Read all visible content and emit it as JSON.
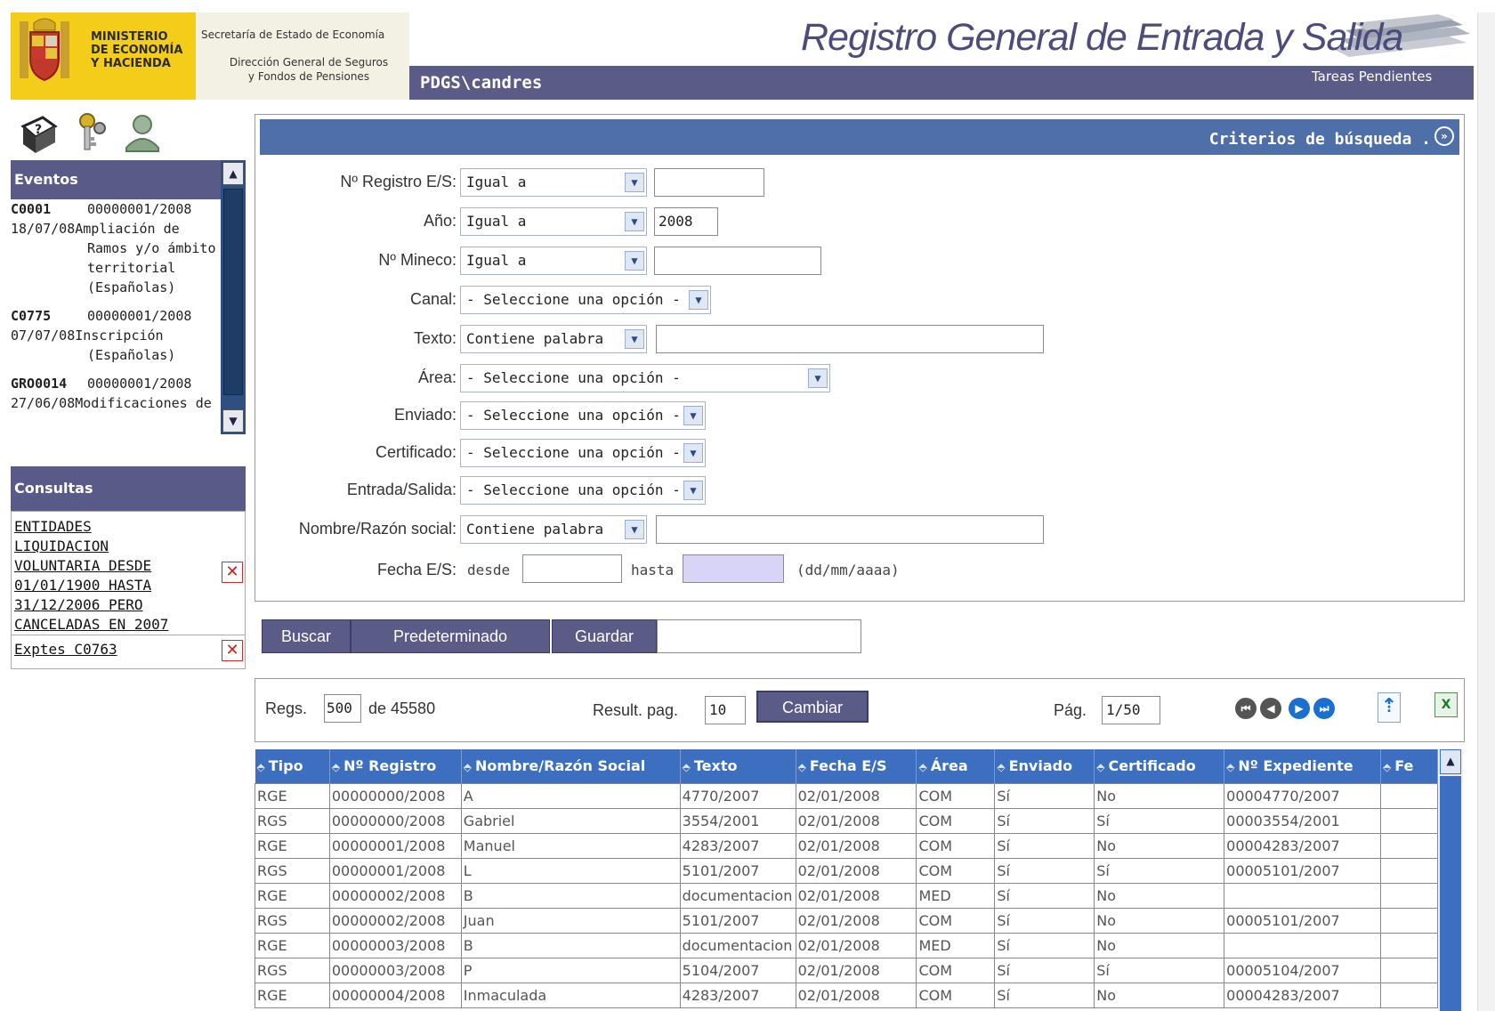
{
  "header": {
    "ministry": [
      "MINISTERIO",
      "DE ECONOMÍA",
      "Y HACIENDA"
    ],
    "secretary": "Secretaría de Estado de Economía",
    "directorate": [
      "Dirección General de Seguros",
      "y Fondos de Pensiones"
    ],
    "app_title": "Registro General de Entrada y Salida",
    "user": "PDGS\\candres",
    "tasks_link": "Tareas Pendientes"
  },
  "toolbar_icons": [
    "help-book-icon",
    "keys-icon",
    "user-icon"
  ],
  "events": {
    "title": "Eventos",
    "items": [
      {
        "code": "C0001",
        "number": "00000001/2008",
        "date": "18/07/08",
        "text": [
          "Ampliación de",
          "Ramos y/o ámbito",
          "territorial",
          "(Españolas)"
        ]
      },
      {
        "code": "C0775",
        "number": "00000001/2008",
        "date": "07/07/08",
        "text": [
          "Inscripción",
          "(Españolas)"
        ]
      },
      {
        "code": "GRO0014",
        "number": "00000001/2008",
        "date": "27/06/08",
        "text": [
          "Modificaciones de"
        ]
      }
    ]
  },
  "queries": {
    "title": "Consultas",
    "items": [
      {
        "lines": [
          "ENTIDADES",
          "LIQUIDACION",
          "VOLUNTARIA DESDE",
          "01/01/1900 HASTA",
          "31/12/2006 PERO",
          "CANCELADAS EN 2007"
        ]
      },
      {
        "lines": [
          "Exptes C0763"
        ]
      }
    ]
  },
  "search": {
    "title": "Criterios de búsqueda .",
    "fields": {
      "registro": {
        "label": "Nº Registro E/S:",
        "op": "Igual a",
        "value": ""
      },
      "anio": {
        "label": "Año:",
        "op": "Igual a",
        "value": "2008"
      },
      "mineco": {
        "label": "Nº Mineco:",
        "op": "Igual a",
        "value": ""
      },
      "canal": {
        "label": "Canal:",
        "op": "- Seleccione una opción -"
      },
      "texto": {
        "label": "Texto:",
        "op": "Contiene palabra",
        "value": ""
      },
      "area": {
        "label": "Área:",
        "op": "- Seleccione una opción -"
      },
      "enviado": {
        "label": "Enviado:",
        "op": "- Seleccione una opción -"
      },
      "certificado": {
        "label": "Certificado:",
        "op": "- Seleccione una opción -"
      },
      "entrada_salida": {
        "label": "Entrada/Salida:",
        "op": "- Seleccione una opción -"
      },
      "nombre": {
        "label": "Nombre/Razón social:",
        "op": "Contiene palabra",
        "value": ""
      },
      "fecha": {
        "label": "Fecha E/S:",
        "desde": "desde",
        "hasta": "hasta",
        "format": "(dd/mm/aaaa)"
      }
    }
  },
  "buttons": {
    "buscar": "Buscar",
    "predeterminado": "Predeterminado",
    "guardar": "Guardar",
    "cambiar": "Cambiar"
  },
  "results": {
    "regs_label": "Regs.",
    "regs_value": "500",
    "total": "de 45580",
    "per_page_label": "Result. pag.",
    "per_page_value": "10",
    "page_label": "Pág.",
    "page_value": "1/50"
  },
  "table": {
    "columns": [
      "Tipo",
      "Nº Registro",
      "Nombre/Razón Social",
      "Texto",
      "Fecha E/S",
      "Área",
      "Enviado",
      "Certificado",
      "Nº Expediente",
      "Fe"
    ],
    "rows": [
      [
        "RGE",
        "00000000/2008",
        "A",
        "4770/2007",
        "02/01/2008",
        "COM",
        "Sí",
        "No",
        "00004770/2007",
        ""
      ],
      [
        "RGS",
        "00000000/2008",
        "Gabriel",
        "3554/2001",
        "02/01/2008",
        "COM",
        "Sí",
        "Sí",
        "00003554/2001",
        ""
      ],
      [
        "RGE",
        "00000001/2008",
        "Manuel",
        "4283/2007",
        "02/01/2008",
        "COM",
        "Sí",
        "No",
        "00004283/2007",
        ""
      ],
      [
        "RGS",
        "00000001/2008",
        "L",
        "5101/2007",
        "02/01/2008",
        "COM",
        "Sí",
        "Sí",
        "00005101/2007",
        ""
      ],
      [
        "RGE",
        "00000002/2008",
        "B",
        "documentacion",
        "02/01/2008",
        "MED",
        "Sí",
        "No",
        "",
        ""
      ],
      [
        "RGS",
        "00000002/2008",
        "Juan",
        "5101/2007",
        "02/01/2008",
        "COM",
        "Sí",
        "No",
        "00005101/2007",
        ""
      ],
      [
        "RGE",
        "00000003/2008",
        "B",
        "documentacion",
        "02/01/2008",
        "MED",
        "Sí",
        "No",
        "",
        ""
      ],
      [
        "RGS",
        "00000003/2008",
        "P",
        "5104/2007",
        "02/01/2008",
        "COM",
        "Sí",
        "Sí",
        "00005104/2007",
        ""
      ],
      [
        "RGE",
        "00000004/2008",
        "Inmaculada",
        "4283/2007",
        "02/01/2008",
        "COM",
        "Sí",
        "No",
        "00004283/2007",
        ""
      ]
    ]
  }
}
